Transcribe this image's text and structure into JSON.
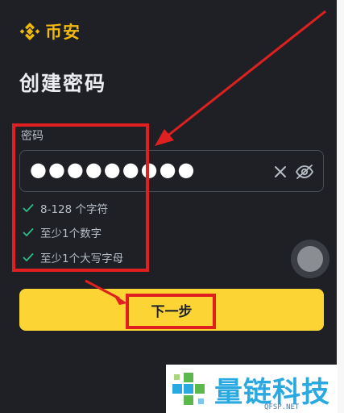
{
  "brand": {
    "name": "币安",
    "color": "#f0b90b",
    "icon": "binance-diamond-logo-icon"
  },
  "page": {
    "title": "创建密码"
  },
  "password_field": {
    "label": "密码",
    "masked_value": "●●●●●●●●●",
    "icons": [
      "clear-icon",
      "eye-off-icon"
    ]
  },
  "rules": [
    {
      "text": "8-128 个字符",
      "icon": "check-icon",
      "satisfied": true
    },
    {
      "text": "至少1个数字",
      "icon": "check-icon",
      "satisfied": true
    },
    {
      "text": "至少1个大写字母",
      "icon": "check-icon",
      "satisfied": true
    }
  ],
  "next_button": {
    "label": "下一步",
    "color": "#fcd535"
  },
  "watermark": {
    "title": "量链科技",
    "subtitle": "QFSP.NET"
  },
  "colors": {
    "background": "#1e2026",
    "annotation": "#e02020",
    "check": "#2ebd85"
  }
}
